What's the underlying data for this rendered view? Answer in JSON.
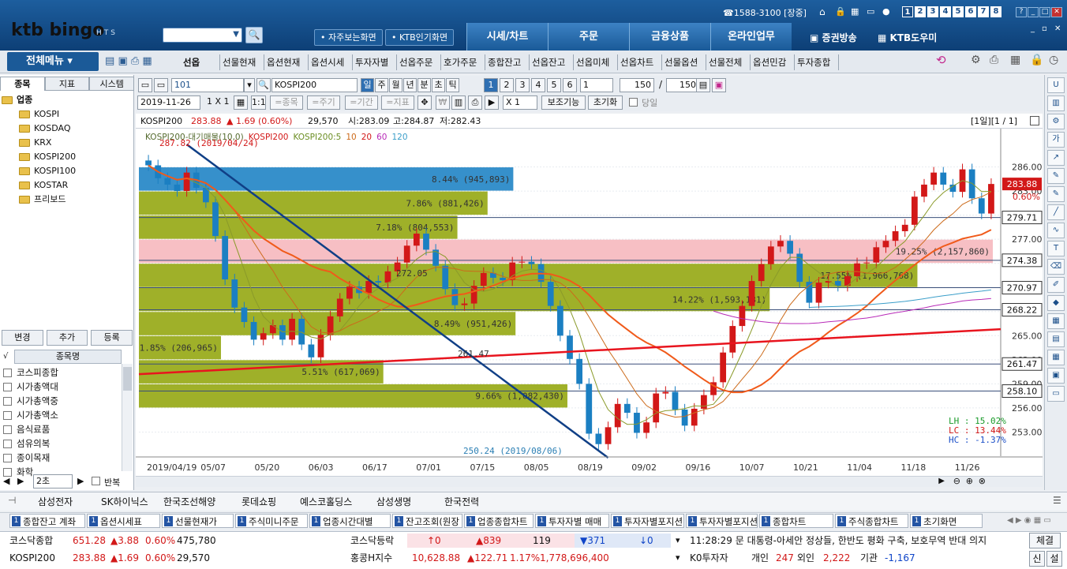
{
  "app": {
    "logo": "ktb bingo",
    "logo_sub": "HTS",
    "phone": "☎1588-3100 [장중]",
    "workspace_nums": [
      "1",
      "2",
      "3",
      "4",
      "5",
      "6",
      "7",
      "8"
    ],
    "quick": [
      "자주보는화면",
      "KTB인기화면"
    ],
    "tabs": [
      "시세/차트",
      "주문",
      "금융상품",
      "온라인업무"
    ],
    "broadcast": "증권방송",
    "helper": "KTB도우미"
  },
  "menubar": {
    "all_menu": "전체메뉴",
    "items": [
      "선옵",
      "선물현재",
      "옵션현재",
      "옵션시세",
      "투자자별",
      "선옵주문",
      "호가주문",
      "종합잔고",
      "선옵잔고",
      "선옵미체",
      "선옵차트",
      "선물옵션",
      "선물전체",
      "옵션민감",
      "투자종합"
    ]
  },
  "left": {
    "tabs": [
      "종목",
      "지표",
      "시스템"
    ],
    "root": "업종",
    "tree": [
      "KOSPI",
      "KOSDAQ",
      "KRX",
      "KOSPI200",
      "KOSPI100",
      "KOSTAR",
      "프리보드"
    ],
    "buttons": [
      "변경",
      "추가",
      "등록"
    ],
    "list_header": "종목명",
    "list": [
      "코스피종합",
      "시가총액대",
      "시가총액중",
      "시가총액소",
      "음식료품",
      "섬유의복",
      "종이목재",
      "화학"
    ],
    "bottom_select": "2초",
    "bottom_check": "반복"
  },
  "toolbar": {
    "code": "101",
    "name": "KOSPI200",
    "periods": [
      "일",
      "주",
      "월",
      "년",
      "분",
      "초",
      "틱"
    ],
    "nums": [
      "1",
      "2",
      "3",
      "4",
      "5",
      "6"
    ],
    "spin1": "1",
    "count": "150",
    "count2": "150",
    "date": "2019-11-26",
    "layout": "1 X 1",
    "b1": "1:1",
    "b_item": "=종목",
    "b_cycle": "=주기",
    "b_period": "=기간",
    "b_ind": "=지표",
    "mult": "X 1",
    "aux": "보조기능",
    "reset": "초기화",
    "today": "당일"
  },
  "info": {
    "name": "KOSPI200",
    "price": "283.88",
    "change": "▲ 1.69 (0.60%)",
    "volume": "29,570",
    "open": "시:283.09",
    "high": "고:284.87",
    "low": "저:282.43",
    "page": "[1일][1 / 1]"
  },
  "chart_data": {
    "type": "candlestick",
    "legend": [
      "KOSPI200-대기매물(10,0)",
      "KOSPI200",
      "KOSPI200:5",
      "10",
      "20",
      "60",
      "120"
    ],
    "x_labels": [
      "2019/04/19",
      "05/07",
      "05/20",
      "06/03",
      "06/17",
      "07/01",
      "07/15",
      "08/05",
      "08/19",
      "09/02",
      "09/16",
      "10/07",
      "10/21",
      "11/04",
      "11/18",
      "11/26"
    ],
    "y_ticks": [
      "286.00",
      "283.00",
      "280.00",
      "277.00",
      "274.00",
      "271.00",
      "268.00",
      "265.00",
      "262.00",
      "259.00",
      "256.00",
      "253.00"
    ],
    "ylim": [
      250,
      289
    ],
    "hlines": [
      "279.71",
      "274.38",
      "270.97",
      "268.22",
      "261.47",
      "258.10"
    ],
    "last_price": "283.88",
    "last_pct": "0.60%",
    "volume_profile": [
      {
        "label": "8.44% (945,893)",
        "pct": 8.44,
        "lo": 283,
        "hi": 286
      },
      {
        "label": "7.86% (881,426)",
        "pct": 7.86,
        "lo": 280,
        "hi": 283
      },
      {
        "label": "7.18% (804,553)",
        "pct": 7.18,
        "lo": 277,
        "hi": 280
      },
      {
        "label": "19.25% (2,157,860)",
        "pct": 19.25,
        "lo": 274,
        "hi": 277
      },
      {
        "label": "17.55% (1,966,768)",
        "pct": 17.55,
        "lo": 271,
        "hi": 274
      },
      {
        "label": "14.22% (1,593,181)",
        "pct": 14.22,
        "lo": 268,
        "hi": 271
      },
      {
        "label": "8.49% (951,426)",
        "pct": 8.49,
        "lo": 265,
        "hi": 268
      },
      {
        "label": "1.85% (206,965)",
        "pct": 1.85,
        "lo": 262,
        "hi": 265
      },
      {
        "label": "5.51% (617,069)",
        "pct": 5.51,
        "lo": 259,
        "hi": 262
      },
      {
        "label": "9.66% (1,082,430)",
        "pct": 9.66,
        "lo": 256,
        "hi": 259
      }
    ],
    "annotations": [
      "287.82 (2019/04/24)",
      "250.24 (2019/08/06)",
      "272.05",
      "261.47"
    ],
    "stats": [
      "LH : 15.02%",
      "LC : 13.44%",
      "HC : -1.37%"
    ],
    "close_series": [
      286.2,
      284.6,
      283.8,
      283.0,
      285.3,
      283.4,
      281.6,
      277.4,
      272.0,
      268.5,
      266.7,
      264.5,
      265.3,
      266.3,
      264.5,
      267.1,
      263.9,
      262.3,
      265.1,
      267.4,
      269.6,
      271.1,
      270.3,
      271.8,
      271.6,
      273.0,
      274.1,
      276.2,
      277.7,
      275.7,
      273.7,
      270.8,
      268.8,
      269.0,
      271.2,
      272.8,
      272.2,
      271.9,
      274.1,
      274.2,
      273.9,
      271.7,
      268.7,
      265.0,
      262.1,
      259.0,
      252.8,
      251.5,
      253.6,
      256.5,
      255.4,
      252.9,
      254.2,
      257.8,
      258.0,
      255.8,
      253.8,
      255.9,
      257.6,
      259.2,
      262.9,
      266.2,
      268.7,
      271.8,
      273.9,
      276.1,
      276.8,
      275.2,
      271.7,
      269.1,
      271.6,
      271.8,
      271.2,
      272.4,
      274.0,
      274.1,
      276.0,
      276.8,
      278.0,
      278.8,
      282.3,
      283.8,
      285.3,
      283.8,
      282.9,
      285.7,
      282.1,
      280.2,
      283.88
    ]
  },
  "stocks": [
    "삼성전자",
    "SK하이닉스",
    "한국조선해양",
    "롯데쇼핑",
    "예스코홀딩스",
    "삼성생명",
    "한국전력"
  ],
  "wtabs": [
    {
      "n": "1",
      "t": "종합잔고 계좌"
    },
    {
      "n": "1",
      "t": "옵션시세표"
    },
    {
      "n": "1",
      "t": "선물현재가"
    },
    {
      "n": "1",
      "t": "주식미니주문"
    },
    {
      "n": "1",
      "t": "업종시간대별"
    },
    {
      "n": "1",
      "t": "잔고조회(원장"
    },
    {
      "n": "1",
      "t": "업종종합차트"
    },
    {
      "n": "1",
      "t": "투자자별 매매"
    },
    {
      "n": "1",
      "t": "투자자별포지션"
    },
    {
      "n": "1",
      "t": "투자자별포지션"
    },
    {
      "n": "1",
      "t": "종합차트"
    },
    {
      "n": "1",
      "t": "주식종합차트"
    },
    {
      "n": "1",
      "t": "초기화면"
    }
  ],
  "bottom": {
    "r1": [
      {
        "t": "코스닥종합"
      },
      {
        "t": "651.28",
        "c": "up"
      },
      {
        "t": "▲3.88",
        "c": "up"
      },
      {
        "t": "0.60%",
        "c": "up"
      },
      {
        "t": "475,780"
      }
    ],
    "r2": [
      {
        "t": "KOSPI200"
      },
      {
        "t": "283.88",
        "c": "up"
      },
      {
        "t": "▲1.69",
        "c": "up"
      },
      {
        "t": "0.60%",
        "c": "up"
      },
      {
        "t": "29,570"
      }
    ],
    "mid1": [
      {
        "t": "코스닥등락"
      },
      {
        "t": "↑0",
        "c": "up"
      },
      {
        "t": "▲839",
        "c": "up"
      },
      {
        "t": "119"
      },
      {
        "t": "▼371",
        "c": "dn"
      },
      {
        "t": "↓0",
        "c": "dn"
      }
    ],
    "mid2": [
      {
        "t": "홍콩H지수"
      },
      {
        "t": "10,628.88",
        "c": "up"
      },
      {
        "t": "▲122.71",
        "c": "up"
      },
      {
        "t": "1.17%",
        "c": "up"
      },
      {
        "t": "1,778,696,400",
        "c": "up"
      }
    ],
    "news": "11:28:29 문 대통령-아세안 정상들, 한반도 평화 구축, 보호무역 반대 의지",
    "inv_label": "K0투자자",
    "inv": [
      {
        "t": "개인"
      },
      {
        "t": "247",
        "c": "up"
      },
      {
        "t": "외인"
      },
      {
        "t": "2,222",
        "c": "up"
      },
      {
        "t": "기관"
      },
      {
        "t": "-1,167",
        "c": "dn"
      }
    ],
    "btn1": "체결",
    "btn2": "신",
    "btn3": "설"
  }
}
